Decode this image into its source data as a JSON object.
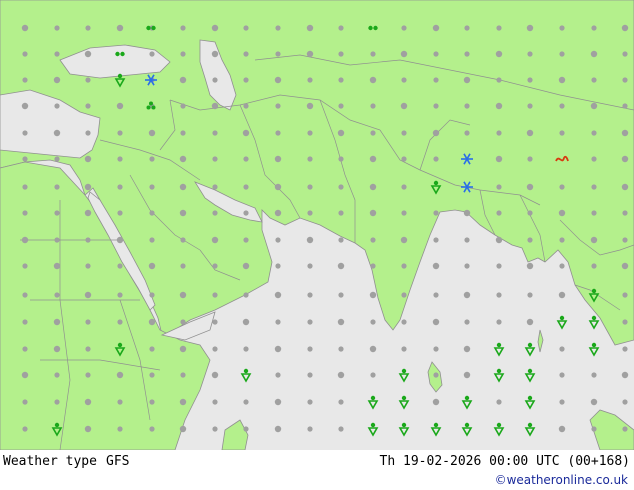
{
  "map": {
    "colors": {
      "land": "#b4f08c",
      "sea": "#e8e8e8",
      "border": "#909090",
      "dot": "#a0a0a0"
    },
    "symbols": {
      "rain_showers": "drop-shower-icon",
      "snow": "snowflake-icon",
      "drizzle": "double-dot-icon",
      "thunder_rain": "cluster-icon",
      "fog": "wave-icon"
    }
  },
  "footer": {
    "title": "Weather type",
    "model": "GFS",
    "valid": "Th 19-02-2026 00:00 UTC (00+168)",
    "credit": "©weatheronline.co.uk"
  }
}
